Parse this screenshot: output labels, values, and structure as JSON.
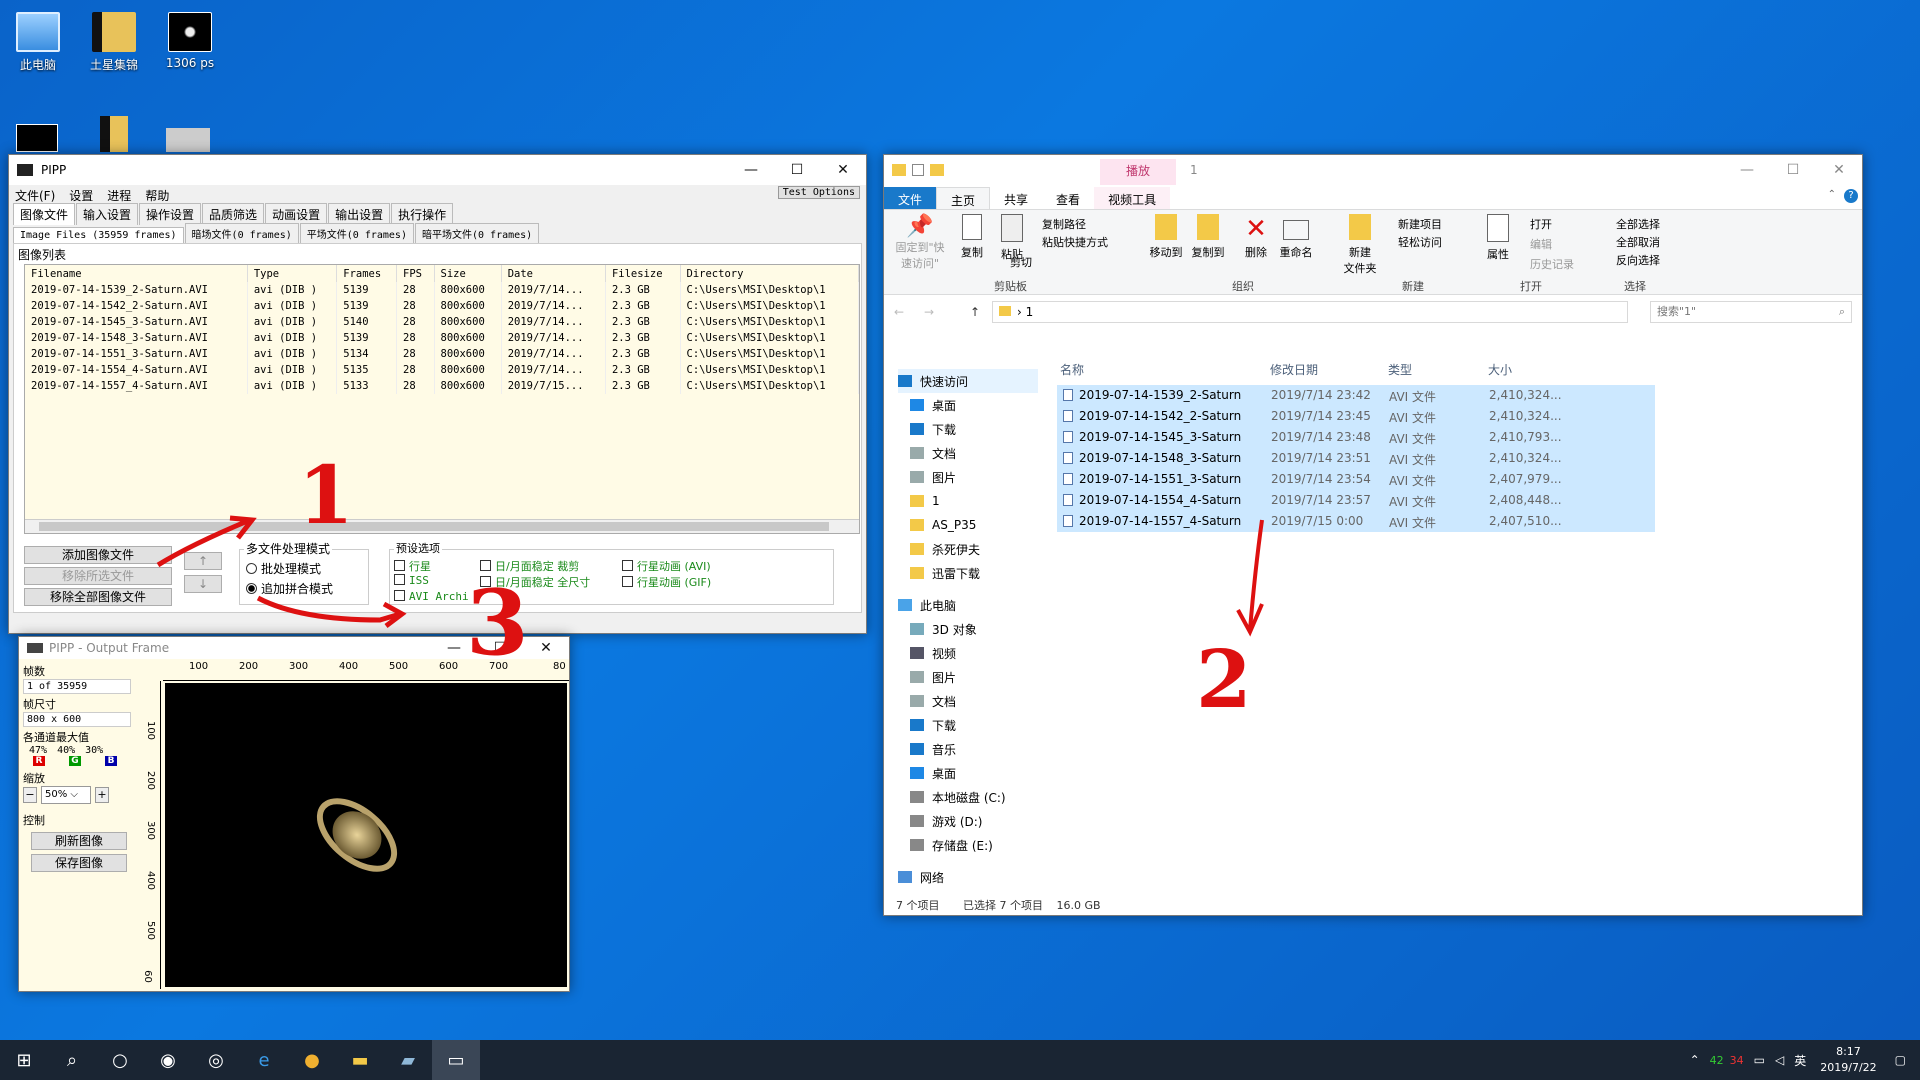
{
  "desktop_icons": [
    {
      "label": "此电脑",
      "icon": "pc-icon"
    },
    {
      "label": "土星集锦",
      "icon": "folder-saturn-icon"
    },
    {
      "label": "1306 ps",
      "icon": "image-file-icon"
    }
  ],
  "pipp": {
    "title": "PIPP",
    "menu": [
      "文件(F)",
      "设置",
      "进程",
      "帮助"
    ],
    "test_options": "Test Options",
    "tabs": [
      "图像文件",
      "输入设置",
      "操作设置",
      "品质筛选",
      "动画设置",
      "输出设置",
      "执行操作"
    ],
    "subtabs": [
      "Image Files (35959 frames)",
      "暗场文件(0 frames)",
      "平场文件(0 frames)",
      "暗平场文件(0 frames)"
    ],
    "list_label": "图像列表",
    "columns": [
      "Filename",
      "Type",
      "Frames",
      "FPS",
      "Size",
      "Date",
      "Filesize",
      "Directory"
    ],
    "rows": [
      [
        "2019-07-14-1539_2-Saturn.AVI",
        "avi (DIB )",
        "5139",
        "28",
        "800x600",
        "2019/7/14...",
        "2.3 GB",
        "C:\\Users\\MSI\\Desktop\\1"
      ],
      [
        "2019-07-14-1542_2-Saturn.AVI",
        "avi (DIB )",
        "5139",
        "28",
        "800x600",
        "2019/7/14...",
        "2.3 GB",
        "C:\\Users\\MSI\\Desktop\\1"
      ],
      [
        "2019-07-14-1545_3-Saturn.AVI",
        "avi (DIB )",
        "5140",
        "28",
        "800x600",
        "2019/7/14...",
        "2.3 GB",
        "C:\\Users\\MSI\\Desktop\\1"
      ],
      [
        "2019-07-14-1548_3-Saturn.AVI",
        "avi (DIB )",
        "5139",
        "28",
        "800x600",
        "2019/7/14...",
        "2.3 GB",
        "C:\\Users\\MSI\\Desktop\\1"
      ],
      [
        "2019-07-14-1551_3-Saturn.AVI",
        "avi (DIB )",
        "5134",
        "28",
        "800x600",
        "2019/7/14...",
        "2.3 GB",
        "C:\\Users\\MSI\\Desktop\\1"
      ],
      [
        "2019-07-14-1554_4-Saturn.AVI",
        "avi (DIB )",
        "5135",
        "28",
        "800x600",
        "2019/7/14...",
        "2.3 GB",
        "C:\\Users\\MSI\\Desktop\\1"
      ],
      [
        "2019-07-14-1557_4-Saturn.AVI",
        "avi (DIB )",
        "5133",
        "28",
        "800x600",
        "2019/7/15...",
        "2.3 GB",
        "C:\\Users\\MSI\\Desktop\\1"
      ]
    ],
    "add_files": "添加图像文件",
    "remove_selected": "移除所选文件",
    "remove_all": "移除全部图像文件",
    "multi_mode_label": "多文件处理模式",
    "mode_batch": "批处理模式",
    "mode_join": "追加拼合模式",
    "preset_label": "预设选项",
    "presets": {
      "planet": "行星",
      "iss": "ISS",
      "avi_archive": "AVI Archi",
      "sunmoon_crop": "日/月面稳定 裁剪",
      "sunmoon_full": "日/月面稳定 全尺寸",
      "anim_avi": "行星动画 (AVI)",
      "anim_gif": "行星动画 (GIF)"
    }
  },
  "output": {
    "title": "PIPP - Output Frame",
    "frames_label": "帧数",
    "frames_value": "1 of 35959",
    "size_label": "帧尺寸",
    "size_value": "800 x 600",
    "channel_label": "各通道最大值",
    "ch": [
      "47%",
      "40%",
      "30%"
    ],
    "ch_letters": [
      "R",
      "G",
      "B"
    ],
    "zoom_label": "缩放",
    "zoom_value": "50%",
    "control_label": "控制",
    "refresh": "刷新图像",
    "save": "保存图像",
    "ruler_x": [
      "100",
      "200",
      "300",
      "400",
      "500",
      "600",
      "700",
      "80"
    ],
    "ruler_y": [
      "100",
      "200",
      "300",
      "400",
      "500",
      "60"
    ]
  },
  "explorer": {
    "title": "1",
    "context_tab": "播放",
    "context_sub": "视频工具",
    "tabs": [
      "文件",
      "主页",
      "共享",
      "查看"
    ],
    "ribbon": {
      "pin": "固定到\"快\n速访问\"",
      "copy": "复制",
      "paste": "粘贴",
      "copy_path": "复制路径",
      "paste_shortcut": "粘贴快捷方式",
      "cut": "剪切",
      "move_to": "移动到",
      "copy_to": "复制到",
      "delete": "删除",
      "rename": "重命名",
      "new_folder": "新建\n文件夹",
      "new_item": "新建项目",
      "easy_access": "轻松访问",
      "properties": "属性",
      "open": "打开",
      "edit": "编辑",
      "history": "历史记录",
      "select_all": "全部选择",
      "select_none": "全部取消",
      "invert": "反向选择",
      "groups": [
        "剪贴板",
        "组织",
        "新建",
        "打开",
        "选择"
      ]
    },
    "path": "1",
    "search_placeholder": "搜索\"1\"",
    "nav": [
      {
        "label": "快速访问",
        "icon": "star-icon"
      },
      {
        "label": "桌面",
        "icon": "desktop-icon"
      },
      {
        "label": "下载",
        "icon": "download-icon"
      },
      {
        "label": "文档",
        "icon": "document-icon"
      },
      {
        "label": "图片",
        "icon": "picture-icon"
      },
      {
        "label": "1",
        "icon": "folder-icon"
      },
      {
        "label": "AS_P35",
        "icon": "folder-icon"
      },
      {
        "label": "杀死伊夫",
        "icon": "folder-icon"
      },
      {
        "label": "迅雷下载",
        "icon": "folder-icon"
      },
      {
        "label": "此电脑",
        "icon": "pc-icon"
      },
      {
        "label": "3D 对象",
        "icon": "cube-icon"
      },
      {
        "label": "视频",
        "icon": "video-icon"
      },
      {
        "label": "图片",
        "icon": "picture-icon"
      },
      {
        "label": "文档",
        "icon": "document-icon"
      },
      {
        "label": "下载",
        "icon": "download-icon"
      },
      {
        "label": "音乐",
        "icon": "music-icon"
      },
      {
        "label": "桌面",
        "icon": "desktop-icon"
      },
      {
        "label": "本地磁盘 (C:)",
        "icon": "drive-icon"
      },
      {
        "label": "游戏 (D:)",
        "icon": "drive-icon"
      },
      {
        "label": "存储盘 (E:)",
        "icon": "drive-icon"
      },
      {
        "label": "网络",
        "icon": "network-icon"
      }
    ],
    "columns": [
      "名称",
      "修改日期",
      "类型",
      "大小"
    ],
    "files": [
      [
        "2019-07-14-1539_2-Saturn",
        "2019/7/14 23:42",
        "AVI 文件",
        "2,410,324..."
      ],
      [
        "2019-07-14-1542_2-Saturn",
        "2019/7/14 23:45",
        "AVI 文件",
        "2,410,324..."
      ],
      [
        "2019-07-14-1545_3-Saturn",
        "2019/7/14 23:48",
        "AVI 文件",
        "2,410,793..."
      ],
      [
        "2019-07-14-1548_3-Saturn",
        "2019/7/14 23:51",
        "AVI 文件",
        "2,410,324..."
      ],
      [
        "2019-07-14-1551_3-Saturn",
        "2019/7/14 23:54",
        "AVI 文件",
        "2,407,979..."
      ],
      [
        "2019-07-14-1554_4-Saturn",
        "2019/7/14 23:57",
        "AVI 文件",
        "2,408,448..."
      ],
      [
        "2019-07-14-1557_4-Saturn",
        "2019/7/15 0:00",
        "AVI 文件",
        "2,407,510..."
      ]
    ],
    "status_count": "7 个项目",
    "status_selected": "已选择 7 个项目",
    "status_size": "16.0 GB"
  },
  "annotations": [
    "1",
    "2",
    "3"
  ],
  "taskbar": {
    "time": "8:17",
    "date": "2019/7/22",
    "ime": "英",
    "net_up": "42",
    "net_down": "34"
  }
}
